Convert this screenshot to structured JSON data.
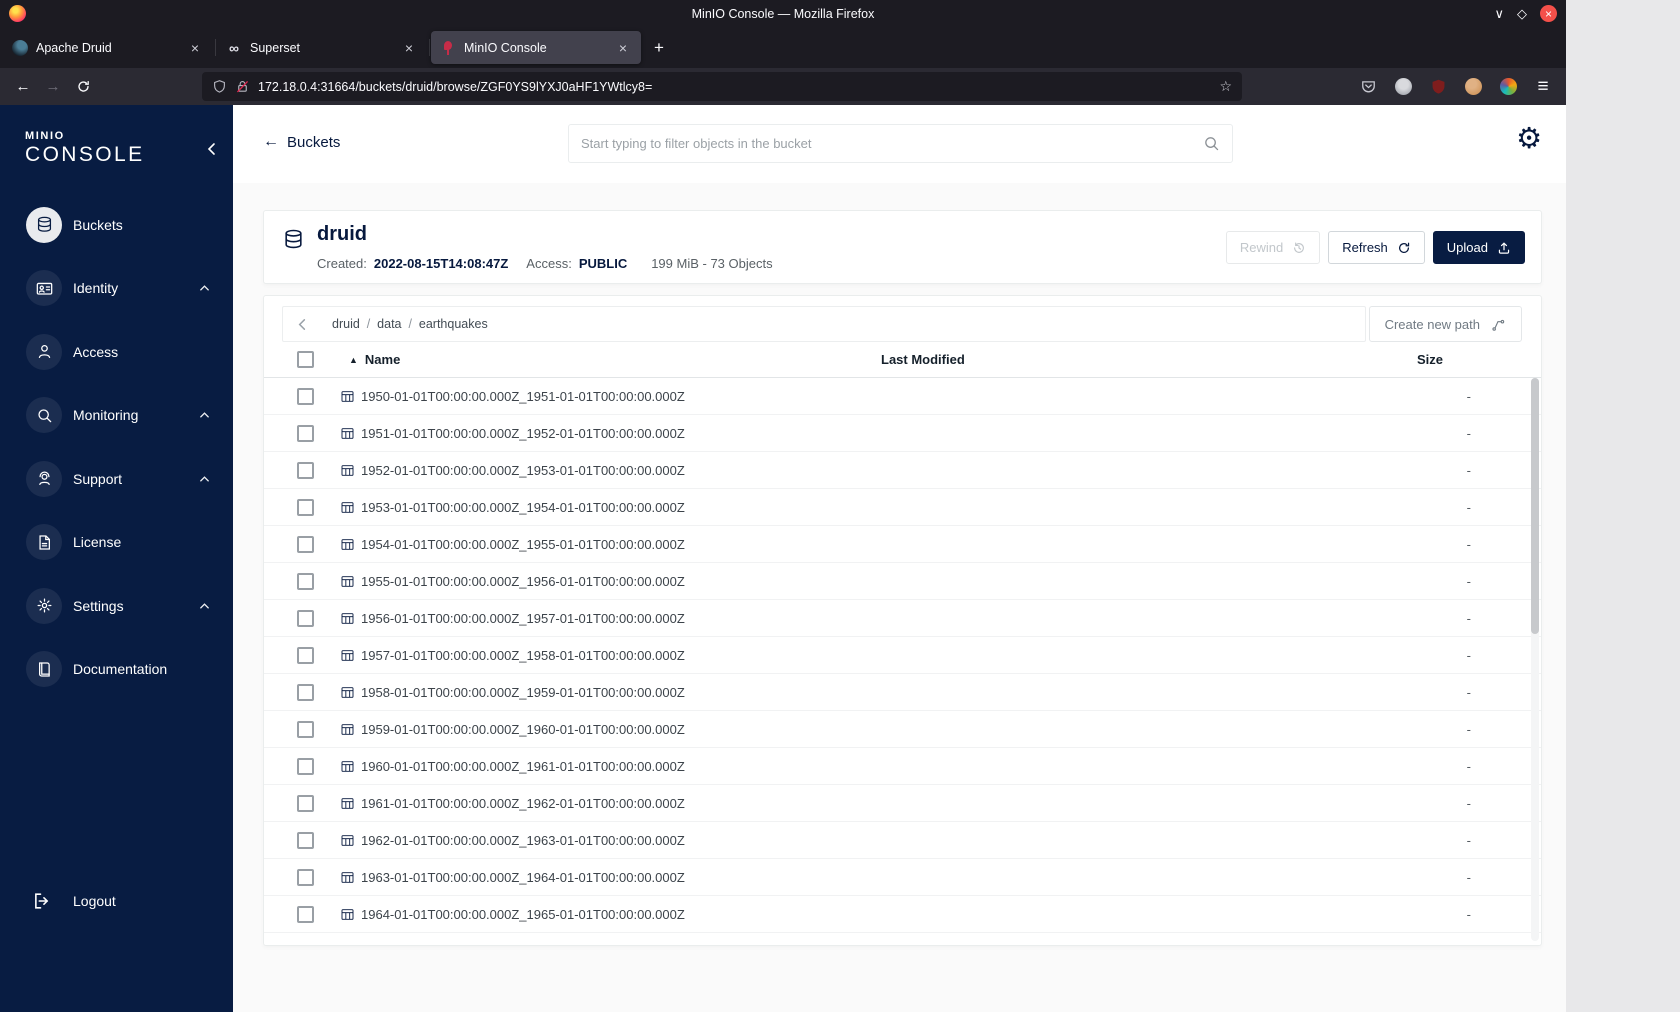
{
  "colors": {
    "sidebar_bg": "#081C42",
    "navy": "#07193E",
    "minio_red": "#C72C48",
    "desktop": "#e8e8ea"
  },
  "titlebar": {
    "title": "MinIO Console — Mozilla Firefox"
  },
  "tabs": [
    {
      "label": "Apache Druid",
      "icon": "druid",
      "active": false
    },
    {
      "label": "Superset",
      "icon": "superset",
      "active": false
    },
    {
      "label": "MinIO Console",
      "icon": "minio",
      "active": true
    }
  ],
  "navbar": {
    "url": "172.18.0.4:31664/buckets/druid/browse/ZGF0YS9lYXJ0aHF1YWtlcy8="
  },
  "sidebar": {
    "logo_top": "MINIO",
    "logo_bottom": "CONSOLE",
    "items": [
      {
        "label": "Buckets",
        "icon": "buckets",
        "active": true,
        "expandable": false
      },
      {
        "label": "Identity",
        "icon": "identity",
        "active": false,
        "expandable": true
      },
      {
        "label": "Access",
        "icon": "access",
        "active": false,
        "expandable": false
      },
      {
        "label": "Monitoring",
        "icon": "monitoring",
        "active": false,
        "expandable": true
      },
      {
        "label": "Support",
        "icon": "support",
        "active": false,
        "expandable": true
      },
      {
        "label": "License",
        "icon": "license",
        "active": false,
        "expandable": false
      },
      {
        "label": "Settings",
        "icon": "settings",
        "active": false,
        "expandable": true
      },
      {
        "label": "Documentation",
        "icon": "documentation",
        "active": false,
        "expandable": false
      }
    ],
    "logout_label": "Logout"
  },
  "header": {
    "back_label": "Buckets",
    "search_placeholder": "Start typing to filter objects in the bucket"
  },
  "bucket": {
    "name": "druid",
    "created_label": "Created:",
    "created_value": "2022-08-15T14:08:47Z",
    "access_label": "Access:",
    "access_value": "PUBLIC",
    "usage": "199 MiB - 73 Objects",
    "buttons": {
      "rewind": "Rewind",
      "refresh": "Refresh",
      "upload": "Upload"
    }
  },
  "browse": {
    "breadcrumb": [
      "druid",
      "data",
      "earthquakes"
    ],
    "create_path_label": "Create new path",
    "columns": {
      "name": "Name",
      "last_modified": "Last Modified",
      "size": "Size"
    }
  },
  "objects": [
    {
      "name": "1950-01-01T00:00:00.000Z_1951-01-01T00:00:00.000Z",
      "size": "-"
    },
    {
      "name": "1951-01-01T00:00:00.000Z_1952-01-01T00:00:00.000Z",
      "size": "-"
    },
    {
      "name": "1952-01-01T00:00:00.000Z_1953-01-01T00:00:00.000Z",
      "size": "-"
    },
    {
      "name": "1953-01-01T00:00:00.000Z_1954-01-01T00:00:00.000Z",
      "size": "-"
    },
    {
      "name": "1954-01-01T00:00:00.000Z_1955-01-01T00:00:00.000Z",
      "size": "-"
    },
    {
      "name": "1955-01-01T00:00:00.000Z_1956-01-01T00:00:00.000Z",
      "size": "-"
    },
    {
      "name": "1956-01-01T00:00:00.000Z_1957-01-01T00:00:00.000Z",
      "size": "-"
    },
    {
      "name": "1957-01-01T00:00:00.000Z_1958-01-01T00:00:00.000Z",
      "size": "-"
    },
    {
      "name": "1958-01-01T00:00:00.000Z_1959-01-01T00:00:00.000Z",
      "size": "-"
    },
    {
      "name": "1959-01-01T00:00:00.000Z_1960-01-01T00:00:00.000Z",
      "size": "-"
    },
    {
      "name": "1960-01-01T00:00:00.000Z_1961-01-01T00:00:00.000Z",
      "size": "-"
    },
    {
      "name": "1961-01-01T00:00:00.000Z_1962-01-01T00:00:00.000Z",
      "size": "-"
    },
    {
      "name": "1962-01-01T00:00:00.000Z_1963-01-01T00:00:00.000Z",
      "size": "-"
    },
    {
      "name": "1963-01-01T00:00:00.000Z_1964-01-01T00:00:00.000Z",
      "size": "-"
    },
    {
      "name": "1964-01-01T00:00:00.000Z_1965-01-01T00:00:00.000Z",
      "size": "-"
    }
  ]
}
